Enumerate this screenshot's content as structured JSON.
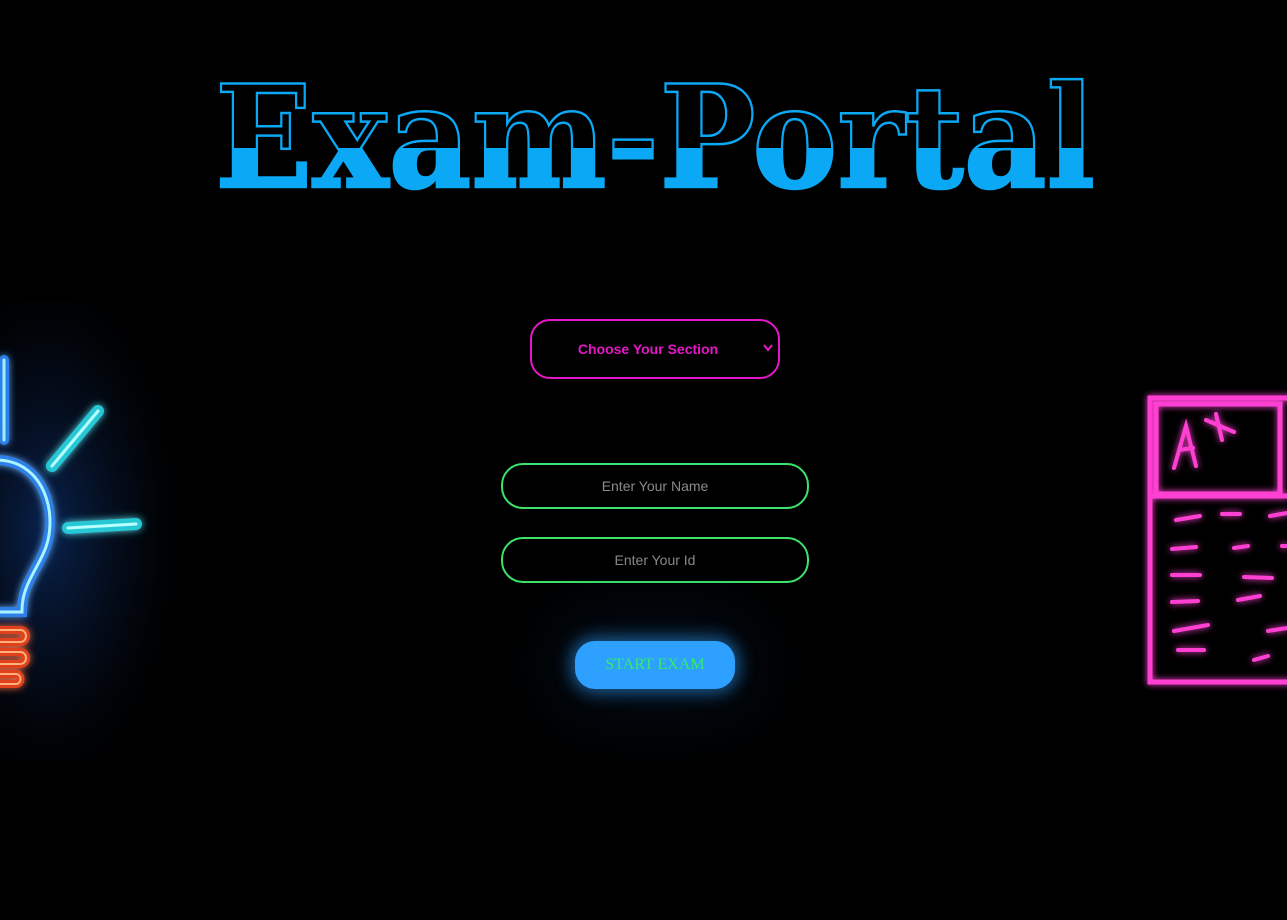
{
  "header": {
    "title": "Exam-Portal"
  },
  "form": {
    "section_select": {
      "selected": "Choose Your Section",
      "options": [
        "Choose Your Section"
      ]
    },
    "name_field": {
      "placeholder": "Enter Your Name",
      "value": ""
    },
    "id_field": {
      "placeholder": "Enter Your Id",
      "value": ""
    },
    "start_button_label": "START EXAM"
  },
  "decorations": {
    "left_icon": "neon-lightbulb-icon",
    "right_icon": "neon-exam-paper-icon",
    "paper_grade": "A+"
  },
  "colors": {
    "background": "#000000",
    "title": "#0aa8f5",
    "select_accent": "#e617c8",
    "input_accent": "#3be36b",
    "button_bg": "#2ea0ff",
    "button_text": "#34ec6a",
    "neon_cyan": "#32d8f0",
    "neon_pink": "#ff3fd2",
    "neon_orange": "#ff5a1c"
  }
}
